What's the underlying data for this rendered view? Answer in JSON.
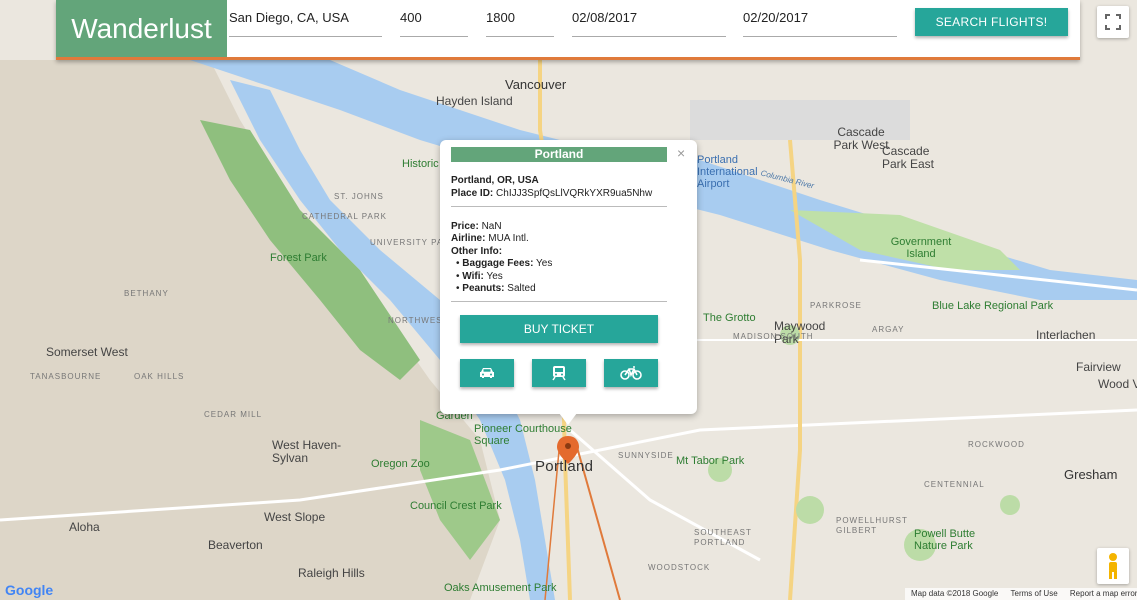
{
  "header": {
    "brand": "Wanderlust",
    "origin": "San Diego, CA, USA",
    "min_price": "400",
    "max_price": "1800",
    "depart_date": "02/08/2017",
    "return_date": "02/20/2017",
    "search_label": "SEARCH FLIGHTS!"
  },
  "popup": {
    "title": "Portland",
    "close": "×",
    "address": "Portland, OR, USA",
    "place_id_label": "Place ID:",
    "place_id": "ChIJJ3SpfQsLlVQRkYXR9ua5Nhw",
    "price_label": "Price:",
    "price": "NaN",
    "airline_label": "Airline:",
    "airline": "MUA Intl.",
    "other_label": "Other Info:",
    "info": [
      {
        "label": "Baggage Fees:",
        "value": "Yes"
      },
      {
        "label": "Wifi:",
        "value": "Yes"
      },
      {
        "label": "Peanuts:",
        "value": "Salted"
      }
    ],
    "buy_label": "BUY TICKET",
    "modes": [
      "car-icon",
      "train-icon",
      "bike-icon"
    ]
  },
  "map": {
    "labels": {
      "vancouver": "Vancouver",
      "hayden_island": "Hayden Island",
      "historic": "Historic",
      "st_johns": "ST. JOHNS",
      "cathedral_park": "CATHEDRAL PARK",
      "university_park": "UNIVERSITY PARK",
      "forest_park": "Forest Park",
      "bethany": "BETHANY",
      "somerset_west": "Somerset West",
      "tanasbourne": "TANASBOURNE",
      "oak_hills": "OAK HILLS",
      "cedar_mill": "CEDAR MILL",
      "west_haven": "West Haven-Sylvan",
      "west_slope": "West Slope",
      "beaverton": "Beaverton",
      "raleigh_hills": "Raleigh Hills",
      "aloha": "Aloha",
      "oregon_zoo": "Oregon Zoo",
      "council_crest": "Council Crest Park",
      "pioneer": "Pioneer Courthouse Square",
      "garden": "Garden",
      "portland": "Portland",
      "sunnyside": "SUNNYSIDE",
      "mt_tabor": "Mt Tabor Park",
      "southeast_portland": "SOUTHEAST PORTLAND",
      "woodstock": "WOODSTOCK",
      "oaks_park": "Oaks Amusement Park",
      "powell_butte": "Powell Butte Nature Park",
      "gresham": "Gresham",
      "centennial": "CENTENNIAL",
      "rockwood": "ROCKWOOD",
      "fairview": "Fairview",
      "wood_village": "Wood Vil",
      "interlachen": "Interlachen",
      "blue_lake": "Blue Lake Regional Park",
      "government_island": "Government Island",
      "cascade_park_west": "Cascade Park West",
      "cascade_park_east": "Cascade Park East",
      "portland_airport": "Portland International Airport",
      "columbia_river": "Columbia River",
      "the_grotto": "The Grotto",
      "maywood_park": "Maywood Park",
      "parkrose": "PARKROSE",
      "argay": "ARGAY",
      "madison_south": "MADISON SOUTH",
      "powellhurst": "POWELLHURST GILBERT",
      "northwest": "NORTHWEST"
    },
    "footer": {
      "map_data": "Map data ©2018 Google",
      "terms": "Terms of Use",
      "report": "Report a map error"
    },
    "google_logo": "Google"
  },
  "colors": {
    "brand_green": "#63a57a",
    "teal": "#26a69a",
    "accent_orange": "#e07a3b"
  }
}
